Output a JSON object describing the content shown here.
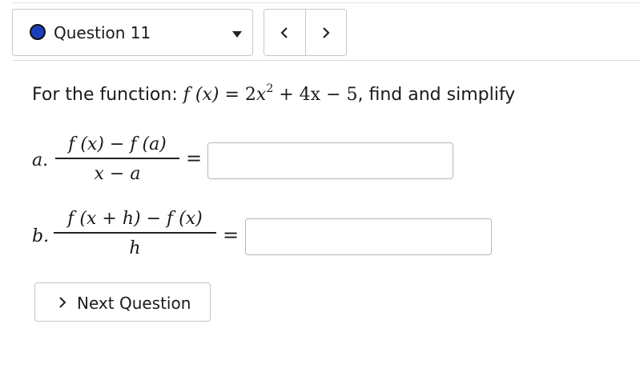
{
  "header": {
    "question_label": "Question 11",
    "status_color": "#1a3fb8",
    "prev_icon": "chevron-left-icon",
    "next_icon": "chevron-right-icon"
  },
  "prompt": {
    "prefix": "For the function: ",
    "function_lhs": "f (x)",
    "equals": "=",
    "coef1": "2",
    "var1": "x",
    "exponent": "2",
    "rest": " + 4x − 5",
    "suffix": ", find and simplify"
  },
  "parts": [
    {
      "letter": "a.",
      "numerator": "f (x) − f (a)",
      "denominator": "x − a",
      "equals": "=",
      "answer_value": ""
    },
    {
      "letter": "b.",
      "numerator": "f (x + h) − f (x)",
      "denominator": "h",
      "equals": "=",
      "answer_value": ""
    }
  ],
  "footer": {
    "next_label": "Next Question"
  }
}
